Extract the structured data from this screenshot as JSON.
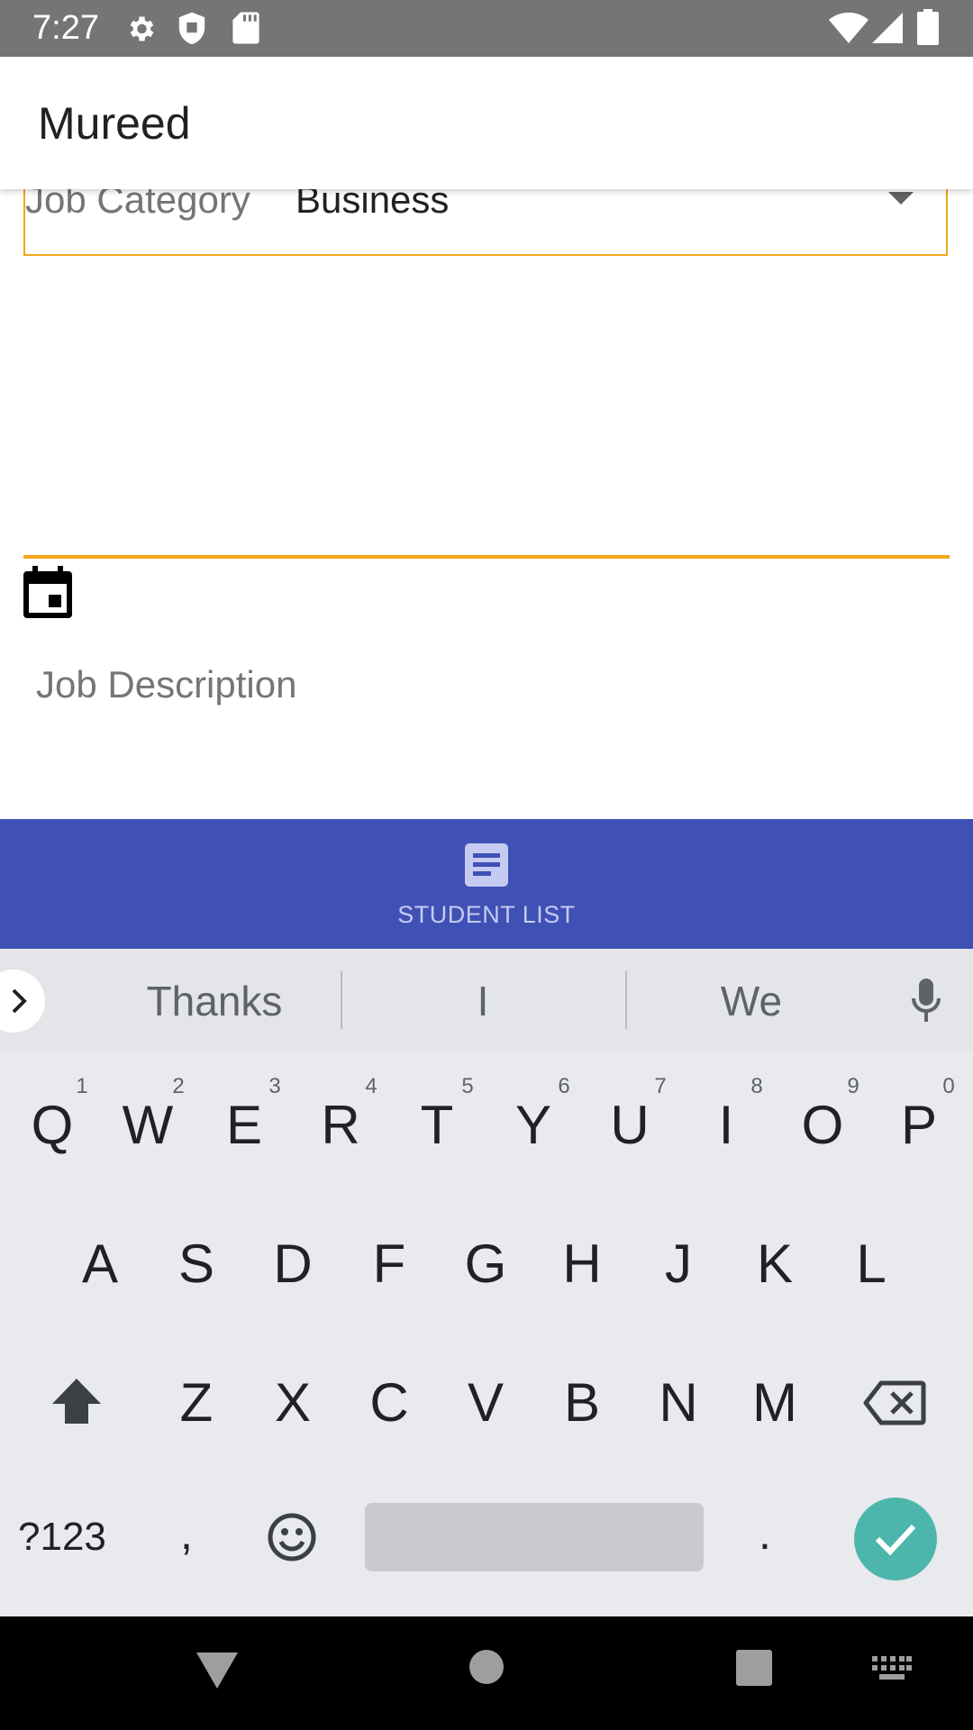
{
  "status_bar": {
    "time": "7:27",
    "left_icons": [
      "gear-icon",
      "shield-icon",
      "sd-card-icon"
    ],
    "right_icons": [
      "wifi-icon",
      "signal-icon",
      "battery-icon"
    ]
  },
  "app_bar": {
    "title": "Mureed"
  },
  "form": {
    "job_category": {
      "label": "Job Category",
      "value": "Business"
    },
    "job_description": {
      "label": "Job Description"
    }
  },
  "bottom_nav": {
    "student_list_label": "STUDENT LIST"
  },
  "keyboard": {
    "suggestions": [
      "Thanks",
      "I",
      "We"
    ],
    "row1": [
      "Q",
      "W",
      "E",
      "R",
      "T",
      "Y",
      "U",
      "I",
      "O",
      "P"
    ],
    "row1_hints": [
      "1",
      "2",
      "3",
      "4",
      "5",
      "6",
      "7",
      "8",
      "9",
      "0"
    ],
    "row2": [
      "A",
      "S",
      "D",
      "F",
      "G",
      "H",
      "J",
      "K",
      "L"
    ],
    "row3": [
      "Z",
      "X",
      "C",
      "V",
      "B",
      "N",
      "M"
    ],
    "symbols_label": "?123",
    "comma": ",",
    "period": "."
  },
  "colors": {
    "accent_orange": "#f2a818",
    "primary_indigo": "#3f51b5",
    "enter_teal": "#4db6ac"
  }
}
